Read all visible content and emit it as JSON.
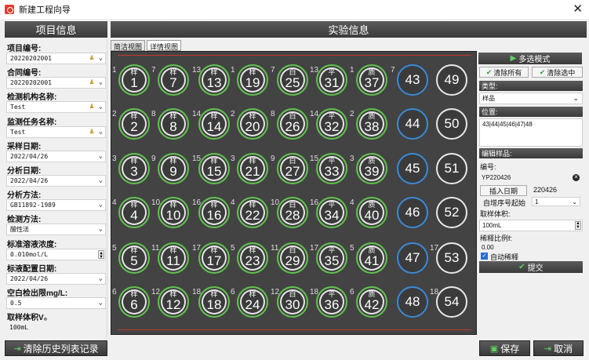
{
  "window": {
    "title": "新建工程向导",
    "close_glyph": "✕"
  },
  "left": {
    "header": "项目信息",
    "fields": [
      {
        "label": "项目编号:",
        "value": "20220202001",
        "kind": "combo-pin"
      },
      {
        "label": "合同编号:",
        "value": "20220202001",
        "kind": "combo-pin"
      },
      {
        "label": "检测机构名称:",
        "value": "Test",
        "kind": "combo-pin"
      },
      {
        "label": "监测任务名称:",
        "value": "Test",
        "kind": "combo-pin"
      },
      {
        "label": "采样日期:",
        "value": "2022/04/26",
        "kind": "combo"
      },
      {
        "label": "分析日期:",
        "value": "2022/04/26",
        "kind": "combo"
      },
      {
        "label": "分析方法:",
        "value": "GB11892-1989",
        "kind": "combo"
      },
      {
        "label": "检测方法:",
        "value": "酸性法",
        "kind": "combo"
      },
      {
        "label": "标准溶液浓度:",
        "value": "0.010mol/L",
        "kind": "spin"
      },
      {
        "label": "标液配置日期:",
        "value": "2022/04/26",
        "kind": "combo"
      },
      {
        "label": "空白检出限mg/L:",
        "value": "0.5",
        "kind": "combo"
      },
      {
        "label": "取样体积V₀",
        "value": "100mL",
        "kind": "text"
      }
    ],
    "clear_history": "清除历史列表记录"
  },
  "right_header": "实验信息",
  "tabs": [
    "简洁视图",
    "详情视图"
  ],
  "vials": [
    {
      "n": "1",
      "tag": "样",
      "idx": "1",
      "style": "green"
    },
    {
      "n": "2",
      "tag": "样",
      "idx": "2",
      "style": "green"
    },
    {
      "n": "3",
      "tag": "样",
      "idx": "3",
      "style": "green"
    },
    {
      "n": "4",
      "tag": "样",
      "idx": "4",
      "style": "green"
    },
    {
      "n": "5",
      "tag": "样",
      "idx": "5",
      "style": "green"
    },
    {
      "n": "6",
      "tag": "样",
      "idx": "6",
      "style": "green"
    },
    {
      "n": "7",
      "tag": "样",
      "idx": "7",
      "style": "green"
    },
    {
      "n": "8",
      "tag": "样",
      "idx": "8",
      "style": "green"
    },
    {
      "n": "9",
      "tag": "样",
      "idx": "9",
      "style": "green"
    },
    {
      "n": "10",
      "tag": "样",
      "idx": "10",
      "style": "green"
    },
    {
      "n": "11",
      "tag": "样",
      "idx": "11",
      "style": "green"
    },
    {
      "n": "12",
      "tag": "样",
      "idx": "12",
      "style": "green"
    },
    {
      "n": "13",
      "tag": "样",
      "idx": "13",
      "style": "green"
    },
    {
      "n": "14",
      "tag": "样",
      "idx": "14",
      "style": "green"
    },
    {
      "n": "15",
      "tag": "样",
      "idx": "15",
      "style": "green"
    },
    {
      "n": "16",
      "tag": "样",
      "idx": "16",
      "style": "green"
    },
    {
      "n": "17",
      "tag": "样",
      "idx": "17",
      "style": "green"
    },
    {
      "n": "18",
      "tag": "样",
      "idx": "18",
      "style": "green"
    },
    {
      "n": "19",
      "tag": "样",
      "idx": "1",
      "style": "green"
    },
    {
      "n": "20",
      "tag": "样",
      "idx": "2",
      "style": "green"
    },
    {
      "n": "21",
      "tag": "样",
      "idx": "3",
      "style": "green"
    },
    {
      "n": "22",
      "tag": "样",
      "idx": "4",
      "style": "green"
    },
    {
      "n": "23",
      "tag": "样",
      "idx": "5",
      "style": "green"
    },
    {
      "n": "24",
      "tag": "样",
      "idx": "6",
      "style": "green"
    },
    {
      "n": "25",
      "tag": "白",
      "idx": "7",
      "style": "green"
    },
    {
      "n": "26",
      "tag": "白",
      "idx": "8",
      "style": "green"
    },
    {
      "n": "27",
      "tag": "白",
      "idx": "9",
      "style": "green"
    },
    {
      "n": "28",
      "tag": "白",
      "idx": "10",
      "style": "green"
    },
    {
      "n": "29",
      "tag": "白",
      "idx": "11",
      "style": "green"
    },
    {
      "n": "30",
      "tag": "白",
      "idx": "12",
      "style": "green"
    },
    {
      "n": "31",
      "tag": "平",
      "idx": "13",
      "style": "green"
    },
    {
      "n": "32",
      "tag": "平",
      "idx": "14",
      "style": "green"
    },
    {
      "n": "33",
      "tag": "平",
      "idx": "15",
      "style": "green"
    },
    {
      "n": "34",
      "tag": "平",
      "idx": "16",
      "style": "green"
    },
    {
      "n": "35",
      "tag": "平",
      "idx": "17",
      "style": "green"
    },
    {
      "n": "36",
      "tag": "平",
      "idx": "18",
      "style": "green"
    },
    {
      "n": "37",
      "tag": "质",
      "idx": "1",
      "style": "green"
    },
    {
      "n": "38",
      "tag": "质",
      "idx": "2",
      "style": "green"
    },
    {
      "n": "39",
      "tag": "质",
      "idx": "3",
      "style": "green"
    },
    {
      "n": "40",
      "tag": "质",
      "idx": "4",
      "style": "green"
    },
    {
      "n": "41",
      "tag": "质",
      "idx": "5",
      "style": "green"
    },
    {
      "n": "42",
      "tag": "质",
      "idx": "6",
      "style": "green"
    },
    {
      "n": "43",
      "tag": "",
      "idx": "7",
      "style": "blue"
    },
    {
      "n": "44",
      "tag": "",
      "idx": "",
      "style": "blue"
    },
    {
      "n": "45",
      "tag": "",
      "idx": "",
      "style": "blue"
    },
    {
      "n": "46",
      "tag": "",
      "idx": "",
      "style": "blue"
    },
    {
      "n": "47",
      "tag": "",
      "idx": "",
      "style": "blue"
    },
    {
      "n": "48",
      "tag": "",
      "idx": "",
      "style": "blue"
    },
    {
      "n": "49",
      "tag": "",
      "idx": "",
      "style": "white"
    },
    {
      "n": "50",
      "tag": "",
      "idx": "",
      "style": "white"
    },
    {
      "n": "51",
      "tag": "",
      "idx": "",
      "style": "white"
    },
    {
      "n": "52",
      "tag": "",
      "idx": "",
      "style": "white"
    },
    {
      "n": "53",
      "tag": "",
      "idx": "17",
      "style": "white"
    },
    {
      "n": "54",
      "tag": "",
      "idx": "18",
      "style": "white"
    }
  ],
  "side": {
    "multi_mode": "多选模式",
    "clear_all": "清除所有",
    "clear_selected": "清除选中",
    "type_label": "类型:",
    "type_value": "样品",
    "position_label": "位置:",
    "position_value": "43|44|45|46|47|48",
    "edit_label": "编辑样品:",
    "id_label": "编号:",
    "id_value": "YP220426",
    "insert_date": "插入日期",
    "date_value": "220426",
    "seq_label": "自增序号起始",
    "seq_value": "1",
    "volume_label": "取样体积:",
    "volume_value": "100mL",
    "dilution_label": "稀释比例f:",
    "dilution_value": "0.00",
    "auto_dilute": "自动稀释",
    "submit": "提交"
  },
  "footer": {
    "save": "保存",
    "cancel": "取消"
  },
  "colors": {
    "vial_green": "#5ec44c",
    "vial_blue": "#3a8ad8",
    "panel_dark": "#434343"
  }
}
